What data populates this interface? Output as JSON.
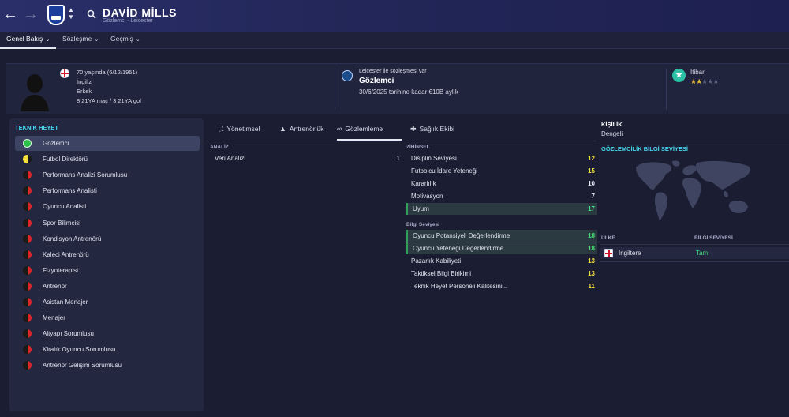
{
  "header": {
    "player_name": "DAVİD MİLLS",
    "player_subtitle": "Gözlemci - Leicester"
  },
  "tabs": [
    {
      "label": "Genel Bakış",
      "active": true
    },
    {
      "label": "Sözleşme"
    },
    {
      "label": "Geçmiş"
    }
  ],
  "info": {
    "age_line": "70 yaşında (6/12/1951)",
    "nationality": "İngiliz",
    "gender": "Erkek",
    "caps": "8 21YA maç / 3 21YA gol",
    "contract_title": "Leicester ile sözleşmesi var",
    "role": "Gözlemci",
    "contract_detail": "30/6/2025 tarihine kadar €10B aylık",
    "reputation_label": "İtibar",
    "reputation_stars": 2,
    "reputation_max": 5
  },
  "staff_panel": {
    "title": "TEKNİK HEYET",
    "items": [
      {
        "label": "Gözlemci",
        "dot": "green"
      },
      {
        "label": "Futbol Direktörü",
        "dot": "yellow"
      },
      {
        "label": "Performans Analizi Sorumlusu",
        "dot": "red"
      },
      {
        "label": "Performans Analisti",
        "dot": "red"
      },
      {
        "label": "Oyuncu Analisti",
        "dot": "red"
      },
      {
        "label": "Spor Bilimcisi",
        "dot": "red"
      },
      {
        "label": "Kondisyon Antrenörü",
        "dot": "red"
      },
      {
        "label": "Kaleci Antrenörü",
        "dot": "red"
      },
      {
        "label": "Fizyoterapist",
        "dot": "red"
      },
      {
        "label": "Antrenör",
        "dot": "red"
      },
      {
        "label": "Asistan Menajer",
        "dot": "red"
      },
      {
        "label": "Menajer",
        "dot": "red"
      },
      {
        "label": "Altyapı Sorumlusu",
        "dot": "red"
      },
      {
        "label": "Kiralık Oyuncu Sorumlusu",
        "dot": "red"
      },
      {
        "label": "Antrenör Gelişim Sorumlusu",
        "dot": "red"
      }
    ]
  },
  "sub_tabs": [
    {
      "label": "Yönetimsel"
    },
    {
      "label": "Antrenörlük"
    },
    {
      "label": "Gözlemleme",
      "active": true
    },
    {
      "label": "Sağlık Ekibi"
    }
  ],
  "analysis": {
    "title": "ANALİZ",
    "rows": [
      {
        "name": "Veri Analizi",
        "value": "1"
      }
    ]
  },
  "mental": {
    "title": "ZİHİNSEL",
    "rows": [
      {
        "name": "Disiplin Seviyesi",
        "value": "12",
        "color": "yellow"
      },
      {
        "name": "Futbolcu İdare Yeteneği",
        "value": "15",
        "color": "yellow"
      },
      {
        "name": "Kararlılık",
        "value": "10",
        "color": "white"
      },
      {
        "name": "Motivasyon",
        "value": "7",
        "color": "white"
      },
      {
        "name": "Uyum",
        "value": "17",
        "color": "green",
        "highlight": true
      }
    ]
  },
  "knowledge": {
    "title": "Bilgi Seviyesi",
    "rows": [
      {
        "name": "Oyuncu Potansiyeli Değerlendirme",
        "value": "18",
        "color": "green",
        "highlight": true
      },
      {
        "name": "Oyuncu Yeteneği Değerlendirme",
        "value": "18",
        "color": "green",
        "highlight": true
      },
      {
        "name": "Pazarlık Kabiliyeti",
        "value": "13",
        "color": "yellow"
      },
      {
        "name": "Taktiksel Bilgi Birikimi",
        "value": "13",
        "color": "yellow"
      },
      {
        "name": "Teknik Heyet Personeli Kalitesini...",
        "value": "11",
        "color": "yellow"
      }
    ]
  },
  "personality": {
    "title": "KİŞİLİK",
    "value": "Dengeli"
  },
  "scouting": {
    "title": "GÖZLEMCİLİK BİLGİ SEVİYESİ",
    "col_country": "ÜLKE",
    "col_level": "BİLGİ SEVİYESİ",
    "rows": [
      {
        "country": "İngiltere",
        "level": "Tam"
      }
    ]
  },
  "colors": {
    "accent_cyan": "#48d7ef",
    "value_yellow": "#f3e03b",
    "value_green": "#41e07b"
  }
}
